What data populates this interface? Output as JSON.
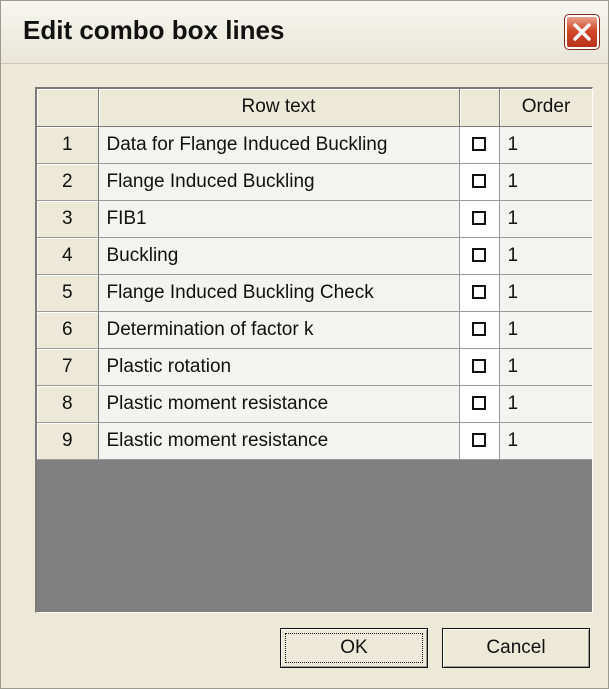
{
  "window": {
    "title": "Edit combo box lines",
    "close_icon": "close-icon"
  },
  "grid": {
    "columns": [
      "",
      "Row text",
      "",
      "Order"
    ],
    "rows": [
      {
        "num": "1",
        "text": "Data for Flange Induced Buckling",
        "checked": false,
        "order": "1"
      },
      {
        "num": "2",
        "text": "Flange Induced Buckling",
        "checked": false,
        "order": "1"
      },
      {
        "num": "3",
        "text": "FIB1",
        "checked": false,
        "order": "1"
      },
      {
        "num": "4",
        "text": "Buckling",
        "checked": false,
        "order": "1"
      },
      {
        "num": "5",
        "text": "Flange Induced Buckling Check",
        "checked": false,
        "order": "1"
      },
      {
        "num": "6",
        "text": "Determination of factor k",
        "checked": false,
        "order": "1"
      },
      {
        "num": "7",
        "text": "Plastic rotation",
        "checked": false,
        "order": "1"
      },
      {
        "num": "8",
        "text": "Plastic moment resistance",
        "checked": false,
        "order": "1"
      },
      {
        "num": "9",
        "text": "Elastic moment resistance",
        "checked": false,
        "order": "1"
      }
    ]
  },
  "buttons": {
    "ok_label": "OK",
    "cancel_label": "Cancel"
  }
}
